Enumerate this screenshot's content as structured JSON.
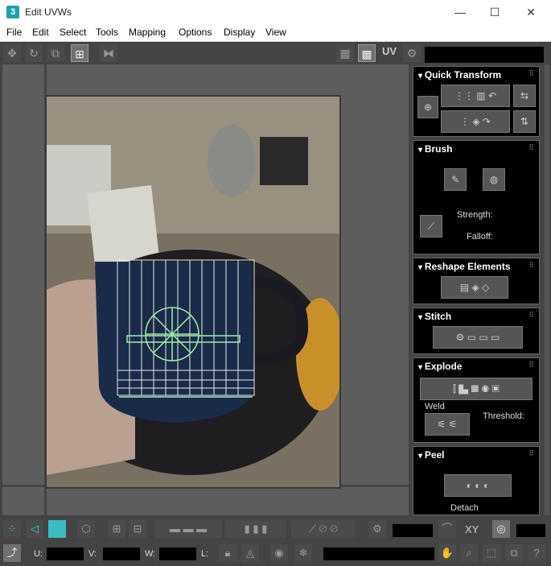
{
  "window": {
    "app_icon": "3",
    "title": "Edit UVWs",
    "minimize": "—",
    "maximize": "☐",
    "close": "✕"
  },
  "menu": [
    "File",
    "Edit",
    "Select",
    "Tools",
    "Mapping",
    "Options",
    "Display",
    "View"
  ],
  "toolbar": {
    "uv_label": "UV"
  },
  "rollouts": {
    "quick_transform": {
      "title": "Quick Transform"
    },
    "brush": {
      "title": "Brush",
      "strength_label": "Strength:",
      "falloff_label": "Falloff:"
    },
    "reshape": {
      "title": "Reshape Elements"
    },
    "stitch": {
      "title": "Stitch"
    },
    "explode": {
      "title": "Explode",
      "weld_label": "Weld",
      "threshold_label": "Threshold:"
    },
    "peel": {
      "title": "Peel",
      "detach_label": "Detach"
    }
  },
  "bottom": {
    "xy_label": "XY",
    "u_label": "U:",
    "v_label": "V:",
    "w_label": "W:",
    "l_label": "L:"
  }
}
